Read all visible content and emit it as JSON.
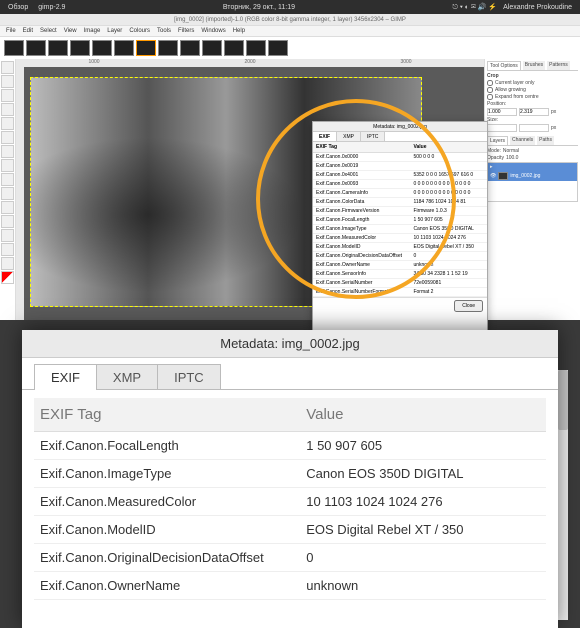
{
  "topbar": {
    "left": [
      "Обзор",
      "gimp-2.9"
    ],
    "center": "Вторник, 29 окт., 11:19",
    "author": "Alexandre Prokoudine"
  },
  "title": "[img_0002] (imported)-1.0 (RGB color 8-bit gamma integer, 1 layer) 3456x2304 – GIMP",
  "menu": [
    "File",
    "Edit",
    "Select",
    "View",
    "Image",
    "Layer",
    "Colours",
    "Tools",
    "Filters",
    "Windows",
    "Help"
  ],
  "meta_small": {
    "title": "Metadata: img_0002.jpg",
    "tabs": [
      "EXIF",
      "XMP",
      "IPTC"
    ],
    "head": [
      "EXIF Tag",
      "Value"
    ],
    "rows": [
      [
        "Exif.Canon.0x0000",
        "500 0 0 0"
      ],
      [
        "Exif.Canon.0x0019",
        ""
      ],
      [
        "Exif.Canon.0x4001",
        "5352 0 0 0 1657 697 616 0"
      ],
      [
        "Exif.Canon.0x0093",
        "0 0 0 0 0 0 0 0 0 0 0 0 0 0"
      ],
      [
        "Exif.Canon.CameraInfo",
        "0 0 0 0 0 0 0 0 0 0 0 0 0 0"
      ],
      [
        "Exif.Canon.ColorData",
        "1184 786 1024 1024 81"
      ],
      [
        "Exif.Canon.FirmwareVersion",
        "Firmware 1.0.3"
      ],
      [
        "Exif.Canon.FocalLength",
        "1 50 907 605"
      ],
      [
        "Exif.Canon.ImageType",
        "Canon EOS 350D DIGITAL"
      ],
      [
        "Exif.Canon.MeasuredColor",
        "10 1103 1024 1024 276"
      ],
      [
        "Exif.Canon.ModelID",
        "EOS Digital Rebel XT / 350"
      ],
      [
        "Exif.Canon.OriginalDecisionDataOffset",
        "0"
      ],
      [
        "Exif.Canon.OwnerName",
        "unknown"
      ],
      [
        "Exif.Canon.SensorInfo",
        "34 30 34 2328 1 1 52 19"
      ],
      [
        "Exif.Canon.SerialNumber",
        "72e0059081"
      ],
      [
        "Exif.Canon.SerialNumberFormat",
        "Format 2"
      ]
    ],
    "close": "Close"
  },
  "right": {
    "tool_tabs": [
      "Tool Options",
      "Brushes",
      "Patterns"
    ],
    "crop": "Crop",
    "opt1": "Current layer only",
    "opt2": "Allow growing",
    "opt3": "Expand from centre",
    "position": "Position:",
    "size": "Size:",
    "px": "px",
    "pos_x": "1.000",
    "pos_y": "2.319",
    "layer_tabs": [
      "Layers",
      "Channels",
      "Paths"
    ],
    "mode": "Mode:",
    "mode_val": "Normal",
    "opacity": "Opacity",
    "opacity_val": "100.0",
    "layer_name": "img_0002.jpg"
  },
  "big": {
    "title": "Metadata: img_0002.jpg",
    "tabs": [
      "EXIF",
      "XMP",
      "IPTC"
    ],
    "head": [
      "EXIF Tag",
      "Value"
    ],
    "rows": [
      [
        "Exif.Canon.FocalLength",
        "1 50 907 605"
      ],
      [
        "Exif.Canon.ImageType",
        "Canon EOS 350D DIGITAL"
      ],
      [
        "Exif.Canon.MeasuredColor",
        "10 1103 1024 1024 276"
      ],
      [
        "Exif.Canon.ModelID",
        "EOS Digital Rebel XT / 350"
      ],
      [
        "Exif.Canon.OriginalDecisionDataOffset",
        "0"
      ],
      [
        "Exif.Canon.OwnerName",
        "unknown"
      ]
    ]
  }
}
